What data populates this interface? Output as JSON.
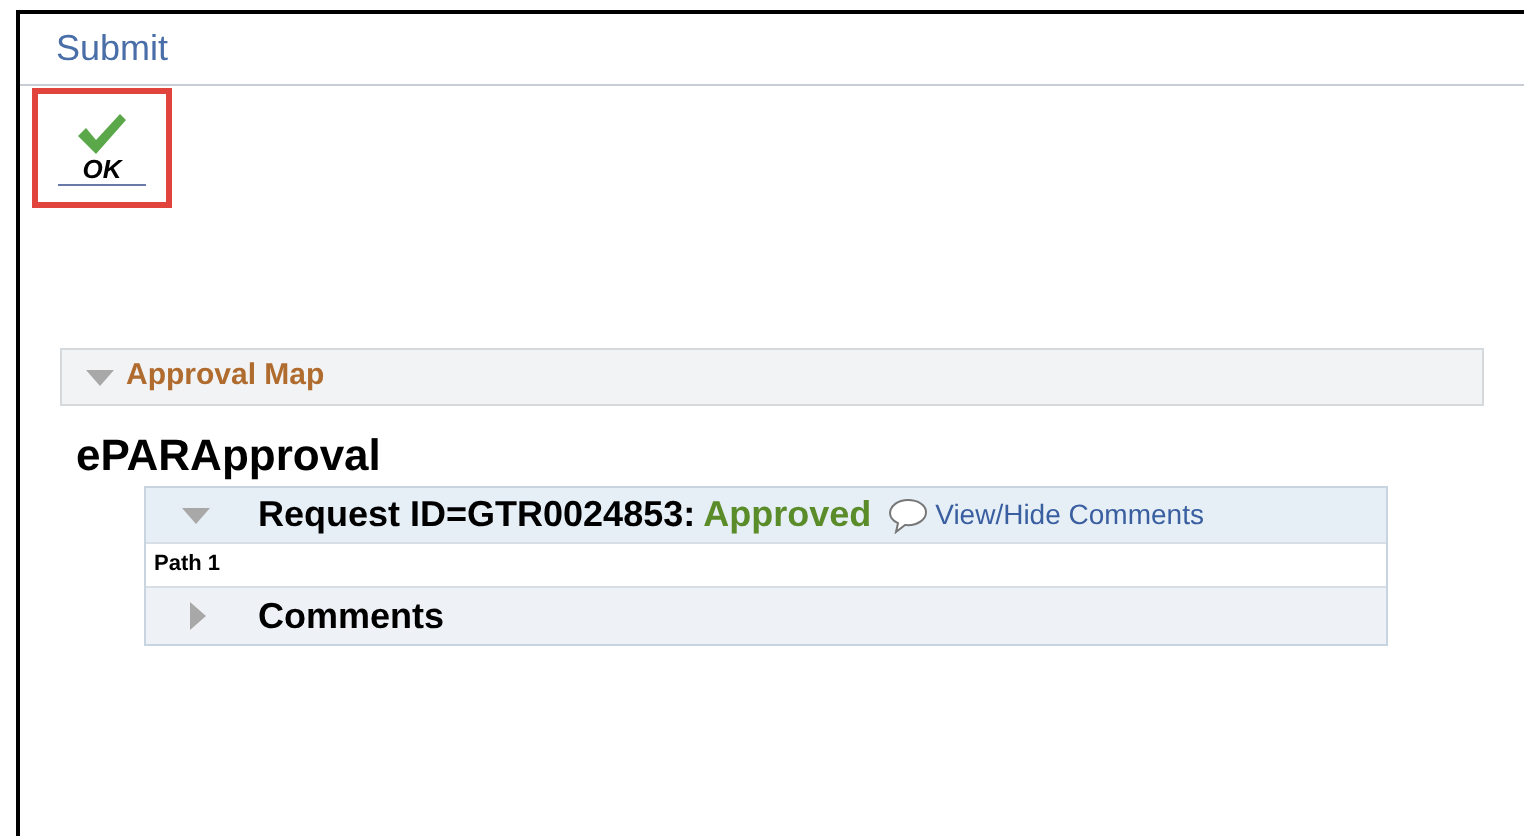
{
  "page_title": "Submit",
  "ok_button": {
    "label": "OK"
  },
  "approval_map": {
    "title": "Approval Map",
    "expanded": true,
    "name": "ePARApproval",
    "request": {
      "label": "Request ID=GTR0024853:",
      "status": "Approved",
      "expanded": true,
      "comments_link": "View/Hide Comments",
      "path": "Path 1",
      "comments": {
        "title": "Comments",
        "expanded": false
      }
    }
  }
}
